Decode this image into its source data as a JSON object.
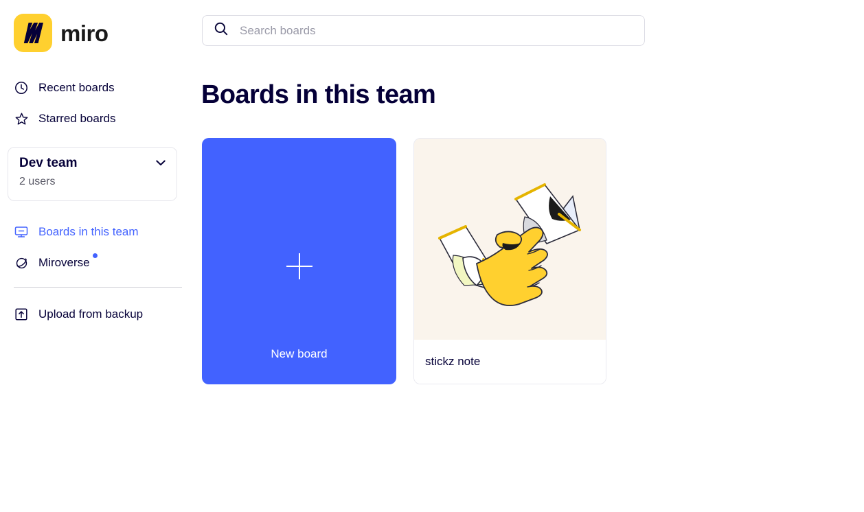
{
  "brand": {
    "name": "miro",
    "logo_icon": "miro-logo-icon",
    "logo_bg": "#FFD02F",
    "wordmark_color": "#1A1A1A"
  },
  "colors": {
    "accent": "#4262FF",
    "text": "#050038",
    "muted": "#595966",
    "placeholder": "#9A9AA8",
    "border": "#E6E6EC",
    "thumb_bg": "#FAF4EC",
    "badge": "#4262FF"
  },
  "sidebar": {
    "top_items": [
      {
        "label": "Recent boards",
        "icon": "clock-icon",
        "active": false
      },
      {
        "label": "Starred boards",
        "icon": "star-icon",
        "active": false
      }
    ],
    "team": {
      "name": "Dev team",
      "users": "2 users",
      "chevron_icon": "chevron-down-icon"
    },
    "mid_items": [
      {
        "label": "Boards in this team",
        "icon": "board-icon",
        "active": true,
        "badge": false
      },
      {
        "label": "Miroverse",
        "icon": "planet-icon",
        "active": false,
        "badge": true
      }
    ],
    "bottom_items": [
      {
        "label": "Upload from backup",
        "icon": "upload-icon",
        "active": false
      }
    ]
  },
  "search": {
    "placeholder": "Search boards",
    "value": "",
    "icon": "search-icon"
  },
  "main": {
    "title": "Boards in this team",
    "new_board": {
      "label": "New board",
      "icon": "plus-icon"
    },
    "boards": [
      {
        "title": "stickz note",
        "thumbnail": "hand-holding-ribbon-illustration"
      }
    ]
  }
}
